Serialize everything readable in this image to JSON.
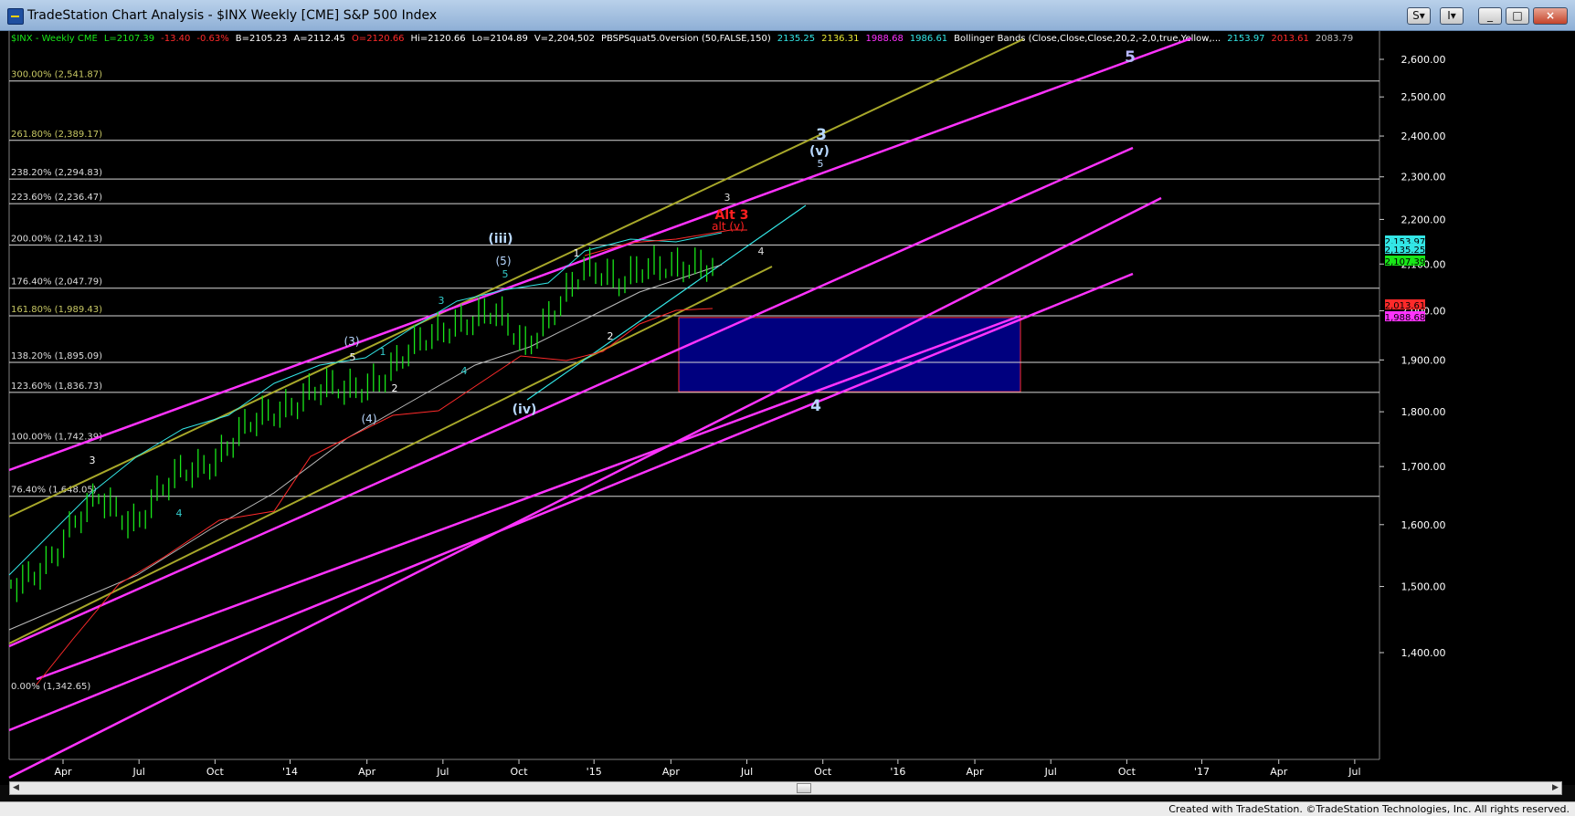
{
  "window": {
    "title": "TradeStation Chart Analysis - $INX Weekly [CME] S&P 500 Index",
    "buttons": [
      "S",
      "I",
      "_",
      "□",
      "×"
    ],
    "status": "Created with TradeStation. ©TradeStation Technologies, Inc. All rights reserved."
  },
  "header": [
    {
      "text": "$INX - Weekly  CME",
      "color": "#19e619"
    },
    {
      "text": "L=2107.39",
      "color": "#19e619"
    },
    {
      "text": "-13.40",
      "color": "#ff2a2a"
    },
    {
      "text": "-0.63%",
      "color": "#ff2a2a"
    },
    {
      "text": "B=2105.23",
      "color": "#ffffff"
    },
    {
      "text": "A=2112.45",
      "color": "#ffffff"
    },
    {
      "text": "O=2120.66",
      "color": "#ff2a2a"
    },
    {
      "text": "Hi=2120.66",
      "color": "#ffffff"
    },
    {
      "text": "Lo=2104.89",
      "color": "#ffffff"
    },
    {
      "text": "V=2,204,502",
      "color": "#ffffff"
    },
    {
      "text": "PBSPSquat5.0version (50,FALSE,150)",
      "color": "#ffffff"
    },
    {
      "text": "2135.25",
      "color": "#33e6e6"
    },
    {
      "text": "2136.31",
      "color": "#e6e633"
    },
    {
      "text": "1988.68",
      "color": "#ff33ff"
    },
    {
      "text": "1986.61",
      "color": "#33e6e6"
    },
    {
      "text": "Bollinger Bands (Close,Close,Close,20,2,-2,0,true,Yellow,...",
      "color": "#ffffff"
    },
    {
      "text": "2153.97",
      "color": "#33e6e6"
    },
    {
      "text": "2013.61",
      "color": "#ff2a2a"
    },
    {
      "text": "2083.79",
      "color": "#bbbbbb"
    }
  ],
  "chart_data": {
    "type": "line",
    "title": "$INX - Weekly CME",
    "ylim": [
      1342,
      2640
    ],
    "y_scale": "log",
    "x_tick_labels": [
      "Apr",
      "Jul",
      "Oct",
      "'14",
      "Apr",
      "Jul",
      "Oct",
      "'15",
      "Apr",
      "Jul",
      "Oct",
      "'16",
      "Apr",
      "Jul",
      "Oct",
      "'17",
      "Apr",
      "Jul"
    ],
    "y_tick_labels": [
      "2,600.00",
      "2,500.00",
      "2,400.00",
      "2,300.00",
      "2,200.00",
      "2,100.00",
      "2,000.00",
      "1,900.00",
      "1,800.00",
      "1,700.00",
      "1,600.00",
      "1,500.00",
      "1,400.00"
    ],
    "fib_levels": [
      {
        "label": "300.00% (2,541.87)",
        "value": 2541.87
      },
      {
        "label": "261.80% (2,389.17)",
        "value": 2389.17
      },
      {
        "label": "238.20% (2,294.83)",
        "value": 2294.83
      },
      {
        "label": "223.60% (2,236.47)",
        "value": 2236.47
      },
      {
        "label": "200.00% (2,142.13)",
        "value": 2142.13
      },
      {
        "label": "176.40% (2,047.79)",
        "value": 2047.79
      },
      {
        "label": "161.80% (1,989.43)",
        "value": 1989.43
      },
      {
        "label": "138.20% (1,895.09)",
        "value": 1895.09
      },
      {
        "label": "123.60% (1,836.73)",
        "value": 1836.73
      },
      {
        "label": "100.00% (1,742.39)",
        "value": 1742.39
      },
      {
        "label": "76.40% (1,648.05)",
        "value": 1648.05
      },
      {
        "label": "0.00% (1,342.65)",
        "value": 1342.65
      }
    ],
    "price_tags": [
      {
        "text": "2,153.97",
        "value": 2153.97,
        "bg": "#33e6e6",
        "fg": "#000000"
      },
      {
        "text": "2,135.25",
        "value": 2135.25,
        "bg": "#33e6e6",
        "fg": "#000000"
      },
      {
        "text": "2,107.39",
        "value": 2107.39,
        "bg": "#19e619",
        "fg": "#000000"
      },
      {
        "text": "2,013.61",
        "value": 2013.61,
        "bg": "#ff2a2a",
        "fg": "#000000"
      },
      {
        "text": "1,988.68",
        "value": 1988.68,
        "bg": "#ff33ff",
        "fg": "#000000"
      }
    ],
    "target_box": {
      "x0": 743,
      "x1": 1117,
      "y_top": 1986,
      "y_bottom": 1838
    },
    "wave_labels": [
      {
        "text": "5",
        "color": "#b8b8ff",
        "size": 17,
        "bold": true
      },
      {
        "text": "3",
        "color": "#b8d8ff",
        "size": 17,
        "bold": true
      },
      {
        "text": "(v)",
        "color": "#b8d8ff",
        "size": 14,
        "bold": true
      },
      {
        "text": "5",
        "color": "#b8d8ff",
        "size": 11,
        "bold": false
      },
      {
        "text": "3",
        "color": "#dddddd",
        "size": 11,
        "bold": false
      },
      {
        "text": "Alt 3",
        "color": "#ff2020",
        "size": 14,
        "bold": true
      },
      {
        "text": "alt (v)",
        "color": "#ff2020",
        "size": 12,
        "bold": false
      },
      {
        "text": "4",
        "color": "#dddddd",
        "size": 11,
        "bold": false
      },
      {
        "text": "(iii)",
        "color": "#b8d8ff",
        "size": 14,
        "bold": true
      },
      {
        "text": "1",
        "color": "#ffffff",
        "size": 11,
        "bold": false
      },
      {
        "text": "(5)",
        "color": "#b8d8ff",
        "size": 12,
        "bold": false
      },
      {
        "text": "5",
        "color": "#33cccc",
        "size": 11,
        "bold": false
      },
      {
        "text": "3",
        "color": "#33cccc",
        "size": 11,
        "bold": false
      },
      {
        "text": "(3)",
        "color": "#b8d8ff",
        "size": 12,
        "bold": false
      },
      {
        "text": "5",
        "color": "#ffffff",
        "size": 11,
        "bold": false
      },
      {
        "text": "1",
        "color": "#33cccc",
        "size": 11,
        "bold": false
      },
      {
        "text": "4",
        "color": "#33cccc",
        "size": 11,
        "bold": false
      },
      {
        "text": "2",
        "color": "#ffffff",
        "size": 11,
        "bold": false
      },
      {
        "text": "2",
        "color": "#ffffff",
        "size": 11,
        "bold": false
      },
      {
        "text": "(4)",
        "color": "#b8d8ff",
        "size": 12,
        "bold": false
      },
      {
        "text": "(iv)",
        "color": "#b8d8ff",
        "size": 14,
        "bold": true
      },
      {
        "text": "4",
        "color": "#b8d8ff",
        "size": 17,
        "bold": true
      },
      {
        "text": "3",
        "color": "#ffffff",
        "size": 11,
        "bold": false
      },
      {
        "text": "4",
        "color": "#33cccc",
        "size": 11,
        "bold": false
      }
    ],
    "colors": {
      "price_bars": "#19e619",
      "channel_magenta": "#ff33ff",
      "channel_olive": "#a8a82a",
      "trend_cyan": "#33e6e6",
      "box_fill": "#00007f",
      "box_border": "#ff2a2a",
      "fib_line": "#d8d8d8"
    }
  }
}
